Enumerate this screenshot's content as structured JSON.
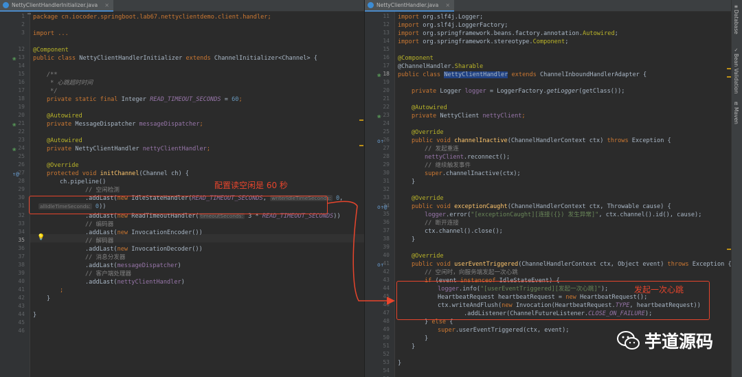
{
  "left": {
    "tab_label": "NettyClientHandlerInitializer.java",
    "line_numbers": [
      "1",
      "2",
      "3",
      "12",
      "13",
      "14",
      "15",
      "16",
      "17",
      "18",
      "19",
      "20",
      "21",
      "22",
      "23",
      "24",
      "25",
      "26",
      "27",
      "28",
      "29",
      "30",
      "31",
      "",
      "32",
      "33",
      "34",
      "35",
      "36",
      "37",
      "38",
      "39",
      "40",
      "41",
      "42",
      "43",
      "44",
      "45",
      "46"
    ],
    "annotation": "配置读空闲是 60 秒",
    "code": {
      "l1_pkg": "package cn.iocoder.springboot.lab67.nettyclientdemo.client.handler;",
      "l3_import": "import ...",
      "l13": "@Component",
      "l14_a": "public class ",
      "l14_b": "NettyClientHandlerInitializer ",
      "l14_c": "extends ",
      "l14_d": "ChannelInitializer<Channel> {",
      "l16": "/**",
      "l17": " * 心跳超时时间",
      "l18": " */",
      "l19_a": "private static final ",
      "l19_b": "Integer ",
      "l19_c": "READ_TIMEOUT_SECONDS",
      "l19_d": " = ",
      "l19_e": "60",
      "l19_f": ";",
      "l21": "@Autowired",
      "l22_a": "private ",
      "l22_b": "MessageDispatcher ",
      "l22_c": "messageDispatcher",
      "l22_d": ";",
      "l24": "@Autowired",
      "l25_a": "private ",
      "l25_b": "NettyClientHandler ",
      "l25_c": "nettyClientHandler",
      "l25_d": ";",
      "l27": "@Override",
      "l28_a": "protected void ",
      "l28_b": "initChannel",
      "l28_c": "(Channel ch) {",
      "l29": "ch.pipeline()",
      "l30": "// 空闲检测",
      "l31_a": ".addLast(",
      "l31_b": "new ",
      "l31_c": "IdleStateHandler(",
      "l31_d": "READ_TIMEOUT_SECONDS",
      "l31_e": ", ",
      "l31_hint": "writerIdleTimeSeconds:",
      "l31_f": " 0",
      "l31_g": ",",
      "l31b_hint": "allIdleTimeSeconds:",
      "l31b_a": " 0",
      "l31b_b": "))",
      "l32_a": ".addLast(",
      "l32_b": "new ",
      "l32_c": "ReadTimeoutHandler(",
      "l32_hint": "timeoutSeconds:",
      "l32_d": " 3 * ",
      "l32_e": "READ_TIMEOUT_SECONDS",
      "l32_f": "))",
      "l33": "// 编码器",
      "l34_a": ".addLast(",
      "l34_b": "new ",
      "l34_c": "InvocationEncoder())",
      "l35": "// 解码器",
      "l36_a": ".addLast(",
      "l36_b": "new ",
      "l36_c": "InvocationDecoder())",
      "l37": "// 消息分发器",
      "l38_a": ".addLast(",
      "l38_b": "messageDispatcher",
      "l38_c": ")",
      "l39": "// 客户端处理器",
      "l40_a": ".addLast(",
      "l40_b": "nettyClientHandler",
      "l40_c": ")",
      "l41": ";",
      "l42": "}",
      "l44": "}"
    }
  },
  "right": {
    "tab_label": "NettyClientHandler.java",
    "line_numbers": [
      "11",
      "12",
      "13",
      "14",
      "15",
      "16",
      "17",
      "18",
      "19",
      "20",
      "21",
      "22",
      "23",
      "24",
      "25",
      "26",
      "27",
      "28",
      "29",
      "30",
      "31",
      "32",
      "33",
      "34",
      "35",
      "36",
      "37",
      "38",
      "39",
      "40",
      "41",
      "42",
      "43",
      "44",
      "45",
      "46",
      "47",
      "48",
      "49",
      "50",
      "51",
      "52",
      "53",
      "54",
      "55"
    ],
    "annotation": "发起一次心跳",
    "code": {
      "r11_a": "import ",
      "r11_b": "org.slf4j.Logger;",
      "r12_a": "import ",
      "r12_b": "org.slf4j.LoggerFactory;",
      "r13_a": "import ",
      "r13_b": "org.springframework.beans.factory.annotation.",
      "r13_c": "Autowired",
      "r13_d": ";",
      "r14_a": "import ",
      "r14_b": "org.springframework.stereotype.",
      "r14_c": "Component",
      "r14_d": ";",
      "r16": "@Component",
      "r17_a": "@ChannelHandler.",
      "r17_b": "Sharable",
      "r18_a": "public class ",
      "r18_b": "NettyClientHandler",
      "r18_c": " extends ",
      "r18_d": "ChannelInboundHandlerAdapter {",
      "r20_a": "private ",
      "r20_b": "Logger ",
      "r20_c": "logger",
      "r20_d": " = LoggerFactory.",
      "r20_e": "getLogger",
      "r20_f": "(getClass());",
      "r22": "@Autowired",
      "r23_a": "private ",
      "r23_b": "NettyClient ",
      "r23_c": "nettyClient",
      "r23_d": ";",
      "r25": "@Override",
      "r26_a": "public void ",
      "r26_b": "channelInactive",
      "r26_c": "(ChannelHandlerContext ctx) ",
      "r26_d": "throws ",
      "r26_e": "Exception {",
      "r27": "// 发起重连",
      "r28_a": "nettyClient",
      "r28_b": ".reconnect();",
      "r29": "// 继续触发事件",
      "r30_a": "super",
      "r30_b": ".channelInactive(ctx);",
      "r31": "}",
      "r33": "@Override",
      "r34_a": "public void ",
      "r34_b": "exceptionCaught",
      "r34_c": "(ChannelHandlerContext ctx, Throwable cause) {",
      "r35_a": "logger",
      "r35_b": ".error(",
      "r35_c": "\"[exceptionCaught][连接({}) 发生异常]\"",
      "r35_d": ", ctx.channel().id(), cause);",
      "r36": "// 断开连接",
      "r37": "ctx.channel().close();",
      "r38": "}",
      "r40": "@Override",
      "r41_a": "public void ",
      "r41_b": "userEventTriggered",
      "r41_c": "(ChannelHandlerContext ctx, Object event) ",
      "r41_d": "throws ",
      "r41_e": "Exception {",
      "r42": "// 空闲时，向服务端发起一次心跳",
      "r43_a": "if ",
      "r43_b": "(event ",
      "r43_c": "instanceof ",
      "r43_d": "IdleStateEvent) {",
      "r44_a": "logger",
      "r44_b": ".info(",
      "r44_c": "\"[userEventTriggered][发起一次心跳]\"",
      "r44_d": ");",
      "r45_a": "HeartbeatRequest heartbeatRequest = ",
      "r45_b": "new ",
      "r45_c": "HeartbeatRequest();",
      "r46_a": "ctx.writeAndFlush(",
      "r46_b": "new ",
      "r46_c": "Invocation(HeartbeatRequest.",
      "r46_d": "TYPE",
      "r46_e": ", heartbeatRequest))",
      "r47_a": ".addListener(ChannelFutureListener.",
      "r47_b": "CLOSE_ON_FAILURE",
      "r47_c": ");",
      "r48_a": "} ",
      "r48_b": "else ",
      "r48_c": "{",
      "r49_a": "super",
      "r49_b": ".userEventTriggered(ctx, event);",
      "r50": "}",
      "r51": "}",
      "r53": "}"
    }
  },
  "sidebar": {
    "database": "Database",
    "bean_validation": "Bean Validation",
    "maven": "Maven"
  },
  "watermark": "芋道源码",
  "colors": {
    "background": "#2b2b2b",
    "keyword": "#cc7832",
    "annotation": "#bbb529",
    "field": "#9876aa",
    "string": "#6a8759",
    "comment": "#808080",
    "number": "#6897bb",
    "method": "#ffc66d",
    "callout": "#e8452c"
  }
}
